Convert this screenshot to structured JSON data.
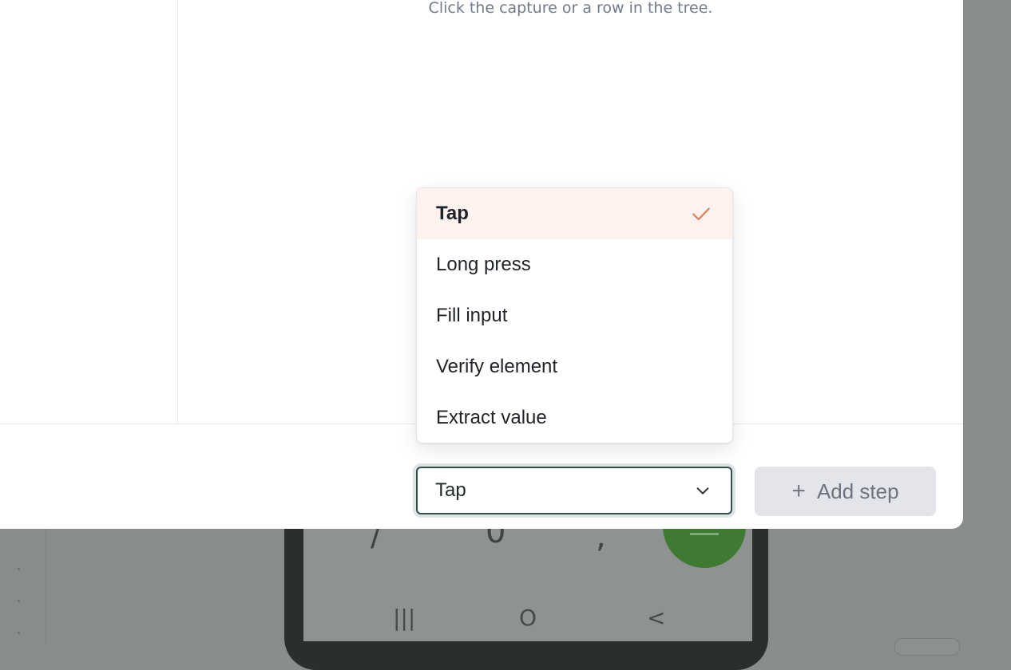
{
  "hint": "Click the capture or a row in the tree.",
  "action_select": {
    "value": "Tap",
    "options": [
      "Tap",
      "Long press",
      "Fill input",
      "Verify element",
      "Extract value"
    ],
    "selected_index": 0
  },
  "add_step_button": {
    "label": "Add step"
  },
  "colors": {
    "accent_check": "#d9805f",
    "selected_bg": "#fdf2ee",
    "select_border": "#2f4f4a"
  },
  "background_phone": {
    "keys": [
      "/",
      "0",
      ","
    ],
    "nav": [
      "|||",
      "O",
      "<"
    ]
  }
}
